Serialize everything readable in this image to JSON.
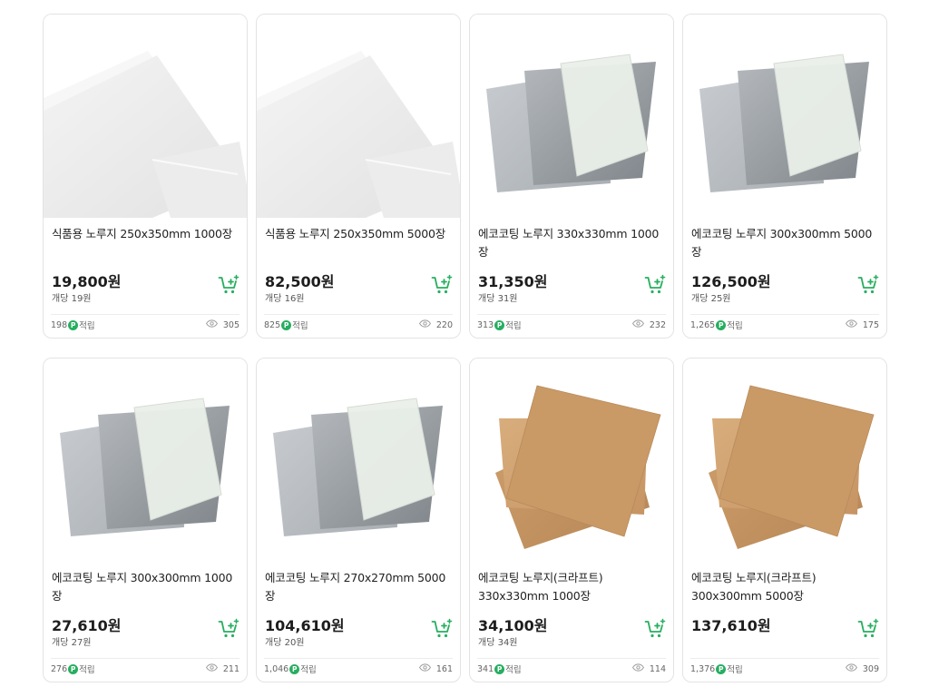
{
  "colors": {
    "accent_green": "#27ae60",
    "border": "#e3e3e3"
  },
  "icons": {
    "cart": "cart-plus-icon",
    "points": "point-p-icon",
    "views": "eye-icon"
  },
  "products": [
    {
      "title": "식품용 노루지 250x350mm 1000장",
      "price": "19,800원",
      "unit_price": "개당 19원",
      "points": "198",
      "points_label": "적립",
      "views": "305",
      "image": "white"
    },
    {
      "title": "식품용 노루지 250x350mm 5000장",
      "price": "82,500원",
      "unit_price": "개당 16원",
      "points": "825",
      "points_label": "적립",
      "views": "220",
      "image": "white"
    },
    {
      "title": "에코코팅 노루지 330x330mm 1000장",
      "price": "31,350원",
      "unit_price": "개당 31원",
      "points": "313",
      "points_label": "적립",
      "views": "232",
      "image": "gray"
    },
    {
      "title": "에코코팅 노루지 300x300mm 5000장",
      "price": "126,500원",
      "unit_price": "개당 25원",
      "points": "1,265",
      "points_label": "적립",
      "views": "175",
      "image": "gray"
    },
    {
      "title": "에코코팅 노루지 300x300mm 1000장",
      "price": "27,610원",
      "unit_price": "개당 27원",
      "points": "276",
      "points_label": "적립",
      "views": "211",
      "image": "gray"
    },
    {
      "title": "에코코팅 노루지 270x270mm 5000장",
      "price": "104,610원",
      "unit_price": "개당 20원",
      "points": "1,046",
      "points_label": "적립",
      "views": "161",
      "image": "gray"
    },
    {
      "title": "에코코팅 노루지(크라프트) 330x330mm 1000장",
      "price": "34,100원",
      "unit_price": "개당 34원",
      "points": "341",
      "points_label": "적립",
      "views": "114",
      "image": "kraft"
    },
    {
      "title": "에코코팅 노루지(크라프트) 300x300mm 5000장",
      "price": "137,610원",
      "unit_price": "",
      "points": "1,376",
      "points_label": "적립",
      "views": "309",
      "image": "kraft"
    }
  ]
}
